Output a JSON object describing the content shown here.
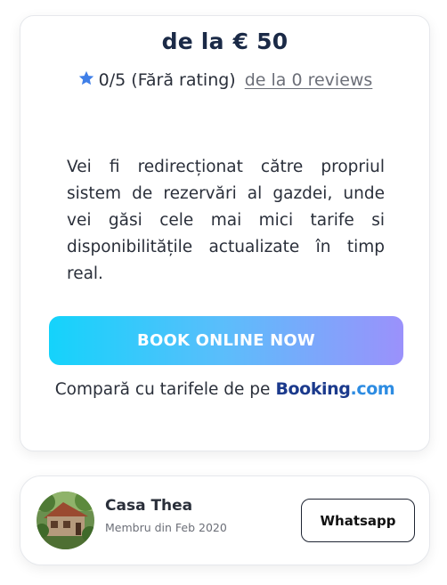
{
  "pricing": {
    "prefix": "de la",
    "amount": "€ 50"
  },
  "rating": {
    "icon": "star-icon",
    "score": "0/5",
    "label": "(Fără rating)",
    "reviews_link": "de la 0 reviews"
  },
  "description": "Vei fi redirecționat către propriul sistem de rezervări al gazdei, unde vei găsi cele mai mici tarife si disponibilitățile actualizate în timp real.",
  "book_button": {
    "label": "BOOK ONLINE NOW"
  },
  "compare": {
    "text": "Compară cu tarifele de pe",
    "logo_part1": "Booking",
    "logo_part2": ".com"
  },
  "host": {
    "name": "Casa Thea",
    "member_since": "Membru din Feb 2020",
    "contact_button": "Whatsapp"
  },
  "colors": {
    "price_text": "#1b2a47",
    "star": "#3f7fe8",
    "button_gradient_start": "#14d3fb",
    "button_gradient_end": "#9b91fb",
    "booking_dark": "#1b3a8c",
    "booking_light": "#2d8ce2"
  }
}
